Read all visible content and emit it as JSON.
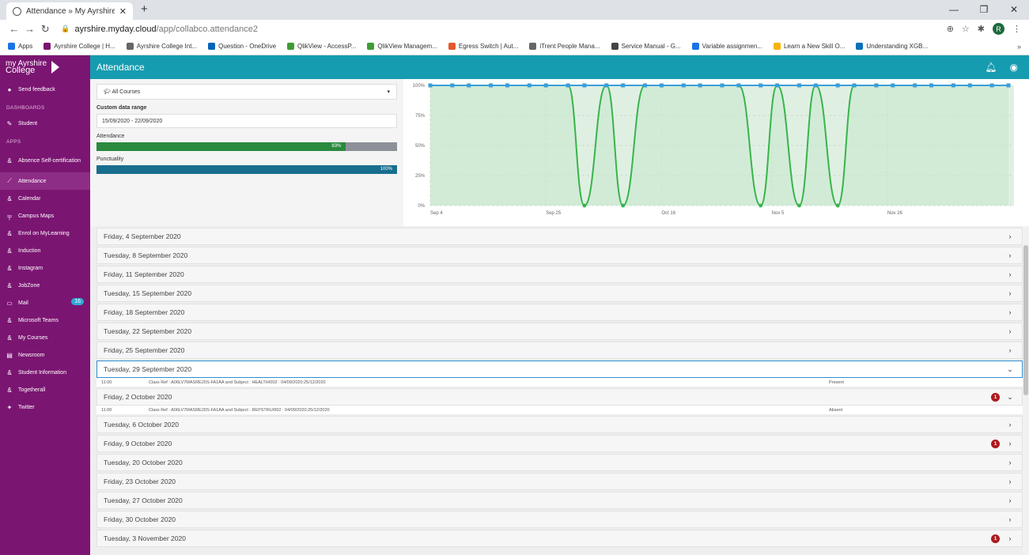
{
  "browser": {
    "tab_title": "Attendance » My Ayrshire Colleg",
    "url_host": "ayrshire.myday.cloud",
    "url_path": "/app/collabco.attendance2",
    "profile_initial": "R",
    "bookmarks": [
      {
        "label": "Apps",
        "color": "#1a73e8"
      },
      {
        "label": "Ayrshire College | H...",
        "color": "#7b1572"
      },
      {
        "label": "Ayrshire College Int...",
        "color": "#666"
      },
      {
        "label": "Question - OneDrive",
        "color": "#0364b8"
      },
      {
        "label": "QlikView - AccessP...",
        "color": "#3f9c35"
      },
      {
        "label": "QlikView Managem...",
        "color": "#3f9c35"
      },
      {
        "label": "Egress Switch | Aut...",
        "color": "#e4572e"
      },
      {
        "label": "iTrent People Mana...",
        "color": "#666"
      },
      {
        "label": "Service Manual - G...",
        "color": "#444"
      },
      {
        "label": "Variable assignmen...",
        "color": "#1a73e8"
      },
      {
        "label": "Learn a New Skill O...",
        "color": "#f5b400"
      },
      {
        "label": "Understanding XGB...",
        "color": "#0b70b5"
      }
    ]
  },
  "app": {
    "logo_line1": "my Ayrshire",
    "logo_line2": "College",
    "title": "Attendance"
  },
  "sidebar": {
    "feedback": "Send feedback",
    "dashboards_label": "DASHBOARDS",
    "student": "Student",
    "apps_label": "APPS",
    "items": [
      {
        "label": "Absence Self-certification",
        "icon": "users-icon",
        "glyph": "&"
      },
      {
        "label": "Attendance",
        "icon": "chart-line-icon",
        "glyph": "⟋"
      },
      {
        "label": "Calendar",
        "icon": "users-icon",
        "glyph": "&"
      },
      {
        "label": "Campus Maps",
        "icon": "signpost-icon",
        "glyph": "╤"
      },
      {
        "label": "Enrol on MyLearning",
        "icon": "users-icon",
        "glyph": "&"
      },
      {
        "label": "Induction",
        "icon": "users-icon",
        "glyph": "&"
      },
      {
        "label": "Instagram",
        "icon": "users-icon",
        "glyph": "&"
      },
      {
        "label": "JobZone",
        "icon": "users-icon",
        "glyph": "&"
      },
      {
        "label": "Mail",
        "icon": "inbox-icon",
        "glyph": "▭",
        "badge": "16"
      },
      {
        "label": "Microsoft Teams",
        "icon": "users-icon",
        "glyph": "&"
      },
      {
        "label": "My Courses",
        "icon": "users-icon",
        "glyph": "&"
      },
      {
        "label": "Newsroom",
        "icon": "newspaper-icon",
        "glyph": "▤"
      },
      {
        "label": "Student Information",
        "icon": "users-icon",
        "glyph": "&"
      },
      {
        "label": "Togetherall",
        "icon": "users-icon",
        "glyph": "&"
      },
      {
        "label": "Twitter",
        "icon": "twitter-icon",
        "glyph": "✦"
      }
    ]
  },
  "filters": {
    "course_select": "All Courses",
    "range_label": "Custom data range",
    "range_value": "15/09/2020 - 22/09/2020",
    "attendance_label": "Attendance",
    "attendance_value": "83%",
    "attendance_pct": 83,
    "punctuality_label": "Punctuality",
    "punctuality_value": "100%",
    "punctuality_pct": 100
  },
  "chart_data": {
    "type": "line",
    "y_ticks": [
      "100%",
      "75%",
      "50%",
      "25%",
      "0%"
    ],
    "ylim": [
      0,
      100
    ],
    "x_ticks": [
      {
        "label": "Sep 4",
        "x": 0
      },
      {
        "label": "Sep 25",
        "x": 21
      },
      {
        "label": "Oct 16",
        "x": 42
      },
      {
        "label": "Nov 5",
        "x": 62
      },
      {
        "label": "Nov 26",
        "x": 83
      }
    ],
    "xlim": [
      0,
      106
    ],
    "series": [
      {
        "color": "#38b44a",
        "x": [
          0,
          4,
          7,
          11,
          14,
          18,
          21,
          25,
          28,
          32,
          35,
          39,
          42,
          46,
          49,
          53,
          56,
          60,
          63,
          67,
          70,
          74,
          77,
          81,
          84,
          88,
          91,
          95,
          98,
          102,
          105
        ],
        "values": [
          100,
          100,
          100,
          100,
          100,
          100,
          100,
          100,
          0,
          100,
          0,
          100,
          100,
          100,
          100,
          100,
          100,
          0,
          100,
          0,
          100,
          0,
          100,
          100,
          100,
          100,
          100,
          100,
          100,
          100,
          100
        ]
      },
      {
        "color": "#3b9ed8",
        "x": [
          0,
          4,
          7,
          11,
          14,
          18,
          21,
          25,
          28,
          32,
          35,
          39,
          42,
          46,
          49,
          53,
          56,
          60,
          63,
          67,
          70,
          74,
          77,
          81,
          84,
          88,
          91,
          95,
          98,
          102,
          105
        ],
        "values": [
          100,
          100,
          100,
          100,
          100,
          100,
          100,
          100,
          100,
          100,
          100,
          100,
          100,
          100,
          100,
          100,
          100,
          100,
          100,
          100,
          100,
          100,
          100,
          100,
          100,
          100,
          100,
          100,
          100,
          100,
          100
        ]
      }
    ]
  },
  "sessions": [
    {
      "date": "Friday, 4 September 2020",
      "open": false,
      "alert": ""
    },
    {
      "date": "Tuesday, 8 September 2020",
      "open": false,
      "alert": ""
    },
    {
      "date": "Friday, 11 September 2020",
      "open": false,
      "alert": ""
    },
    {
      "date": "Tuesday, 15 September 2020",
      "open": false,
      "alert": ""
    },
    {
      "date": "Friday, 18 September 2020",
      "open": false,
      "alert": ""
    },
    {
      "date": "Tuesday, 22 September 2020",
      "open": false,
      "alert": ""
    },
    {
      "date": "Friday, 25 September 2020",
      "open": false,
      "alert": ""
    },
    {
      "date": "Tuesday, 29 September 2020",
      "open": true,
      "selected": true,
      "alert": "",
      "detail": {
        "time": "11:00",
        "desc": "Class Ref : A06LV7MASRE20S-FA1AA and Subject : HEALTH/002 : 04/09/2020:25/12/2020",
        "status": "Present"
      }
    },
    {
      "date": "Friday, 2 October 2020",
      "open": true,
      "alert": "1",
      "detail": {
        "time": "11:00",
        "desc": "Class Ref : A06LV7MASRE20S-FA1AA and Subject : REPSTRU/002 : 04/09/2020:25/12/2020",
        "status": "Absent"
      }
    },
    {
      "date": "Tuesday, 6 October 2020",
      "open": false,
      "alert": ""
    },
    {
      "date": "Friday, 9 October 2020",
      "open": false,
      "alert": "1"
    },
    {
      "date": "Tuesday, 20 October 2020",
      "open": false,
      "alert": ""
    },
    {
      "date": "Friday, 23 October 2020",
      "open": false,
      "alert": ""
    },
    {
      "date": "Tuesday, 27 October 2020",
      "open": false,
      "alert": ""
    },
    {
      "date": "Friday, 30 October 2020",
      "open": false,
      "alert": ""
    },
    {
      "date": "Tuesday, 3 November 2020",
      "open": false,
      "alert": "1"
    }
  ]
}
